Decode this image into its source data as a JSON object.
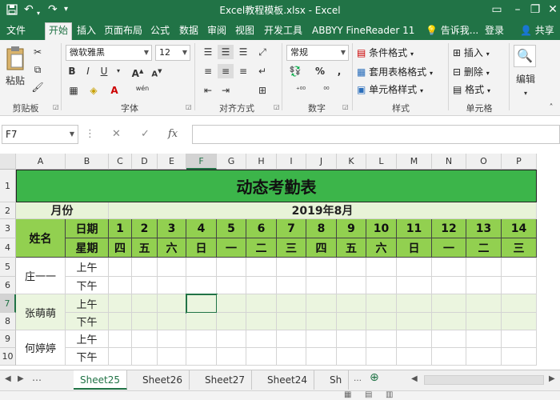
{
  "window": {
    "title": "Excel教程模板.xlsx - Excel"
  },
  "tabs": [
    "文件",
    "开始",
    "插入",
    "页面布局",
    "公式",
    "数据",
    "审阅",
    "视图",
    "开发工具",
    "ABBYY FineReader 11"
  ],
  "tell_me": "告诉我...",
  "login": "登录",
  "share": "共享",
  "ribbon": {
    "clipboard": {
      "label": "剪贴板",
      "paste": "粘贴"
    },
    "font": {
      "label": "字体",
      "name": "微软雅黑",
      "size": "12",
      "bold": "B",
      "italic": "I",
      "underline": "U",
      "phonetic": "wén"
    },
    "alignment": {
      "label": "对齐方式"
    },
    "number": {
      "label": "数字",
      "format": "常规"
    },
    "styles": {
      "label": "样式",
      "conditional": "条件格式",
      "table": "套用表格格式",
      "cell": "单元格样式"
    },
    "cells": {
      "label": "单元格",
      "insert": "插入",
      "delete": "删除",
      "format": "格式"
    },
    "editing": {
      "label": "编辑"
    }
  },
  "formula_bar": {
    "name_box": "F7",
    "fx": "fx"
  },
  "columns": [
    "A",
    "B",
    "C",
    "D",
    "E",
    "F",
    "G",
    "H",
    "I",
    "J",
    "K",
    "L",
    "M",
    "N",
    "O",
    "P"
  ],
  "rows": [
    "1",
    "2",
    "3",
    "4",
    "5",
    "6",
    "7",
    "8",
    "9",
    "10"
  ],
  "sheet": {
    "title": "动态考勤表",
    "month_label": "月份",
    "month_value": "2019年8月",
    "name_header": "姓名",
    "date_label": "日期",
    "week_label": "星期",
    "dates": [
      "1",
      "2",
      "3",
      "4",
      "5",
      "6",
      "7",
      "8",
      "9",
      "10",
      "11",
      "12",
      "13",
      "14"
    ],
    "weekdays": [
      "四",
      "五",
      "六",
      "日",
      "一",
      "二",
      "三",
      "四",
      "五",
      "六",
      "日",
      "一",
      "二",
      "三"
    ],
    "people": [
      "庄一一",
      "张萌萌",
      "何婷婷"
    ],
    "am": "上午",
    "pm": "下午"
  },
  "sheet_tabs": [
    "Sheet25",
    "Sheet26",
    "Sheet27",
    "Sheet24",
    "Sh"
  ],
  "colors": {
    "excel_green": "#217346",
    "title_fill": "#3cb54a",
    "header_fill": "#92d050",
    "stripe_fill": "#ebf5df"
  }
}
